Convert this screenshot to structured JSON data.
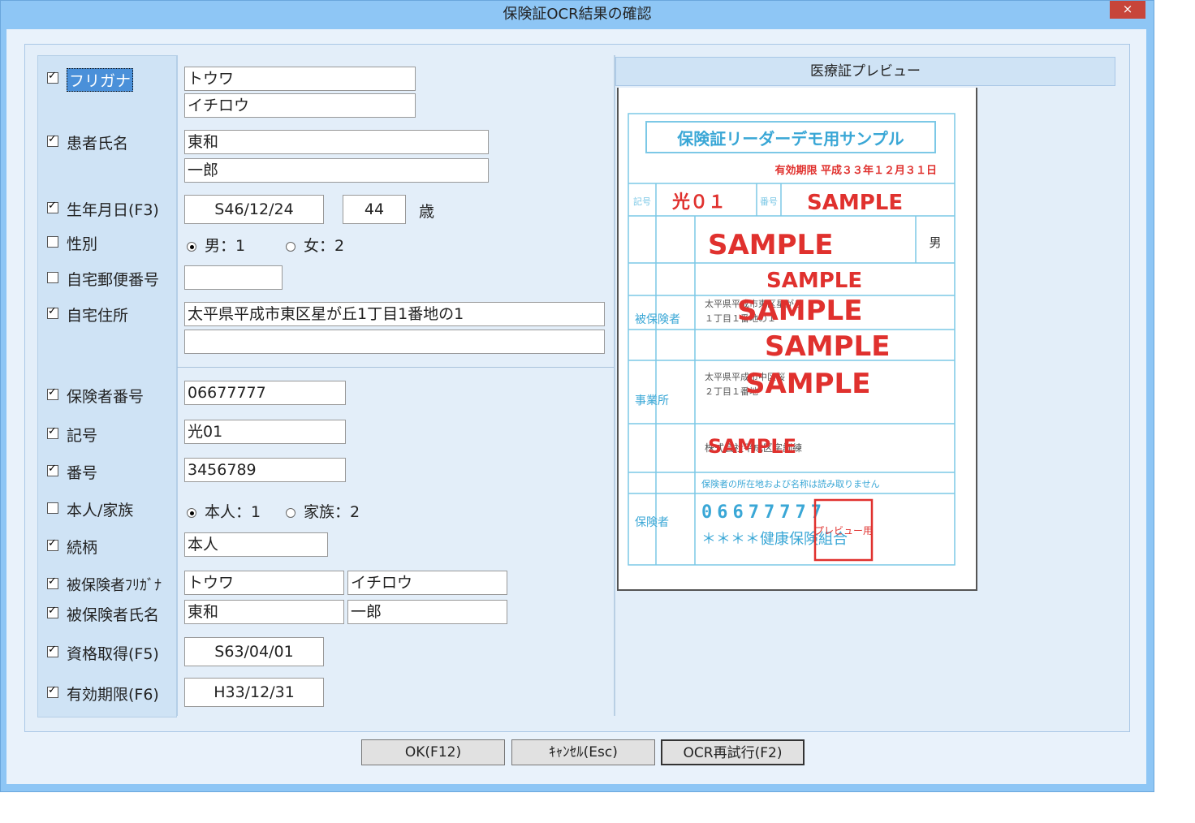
{
  "window": {
    "title": "保険証OCR結果の確認",
    "close_label": "×"
  },
  "fields": {
    "furigana": {
      "label": "フリガナ",
      "checked": true,
      "last": "トウワ",
      "first": "イチロウ"
    },
    "name": {
      "label": "患者氏名",
      "checked": true,
      "last": "東和",
      "first": "一郎"
    },
    "birthday": {
      "label": "生年月日(F3)",
      "checked": true,
      "value": "S46/12/24",
      "age": "44",
      "age_unit": "歳"
    },
    "gender": {
      "label": "性別",
      "checked": false,
      "male": "男：1",
      "female": "女：2",
      "selected": "male"
    },
    "zip": {
      "label": "自宅郵便番号",
      "checked": false,
      "value": ""
    },
    "address": {
      "label": "自宅住所",
      "checked": true,
      "line1": "太平県平成市東区星が丘1丁目1番地の1",
      "line2": ""
    },
    "insurer_no": {
      "label": "保険者番号",
      "checked": true,
      "value": "06677777"
    },
    "symbol": {
      "label": "記号",
      "checked": true,
      "value": "光01"
    },
    "number": {
      "label": "番号",
      "checked": true,
      "value": "3456789"
    },
    "self_family": {
      "label": "本人/家族",
      "checked": false,
      "self": "本人：1",
      "family": "家族：2",
      "selected": "self"
    },
    "relation": {
      "label": "続柄",
      "checked": true,
      "value": "本人"
    },
    "insured_kana": {
      "label": "被保険者ﾌﾘｶﾞﾅ",
      "checked": true,
      "last": "トウワ",
      "first": "イチロウ"
    },
    "insured_name": {
      "label": "被保険者氏名",
      "checked": true,
      "last": "東和",
      "first": "一郎"
    },
    "qualified": {
      "label": "資格取得(F5)",
      "checked": true,
      "value": "S63/04/01"
    },
    "expiry": {
      "label": "有効期限(F6)",
      "checked": true,
      "value": "H33/12/31"
    }
  },
  "preview": {
    "title": "医療証プレビュー",
    "card_title": "保険証リーダーデモ用サンプル",
    "card_expiry": "有効期限 平成３３年１２月３１日",
    "symbol_label": "記号",
    "symbol_value": "光０１",
    "number_label": "番号",
    "sample": "SAMPLE",
    "gender": "男",
    "insured_label": "被保険者",
    "office_label": "事業所",
    "insurer_label": "保険者",
    "insurer_digits": "06677777",
    "insurer_name": "＊＊＊＊健康保険組合",
    "address_small": "太平県平成市東区星が丘",
    "address_small2": "１丁目１番地の１",
    "office_addr": "太平県平成市中区桜",
    "office_addr2": "２丁目１番地",
    "office_name": "株式会社平成区字訓練",
    "insurer_note": "保険者の所在地および名称は読み取りません",
    "seal": "プレビュー用"
  },
  "buttons": {
    "ok": "OK(F12)",
    "cancel": "ｷｬﾝｾﾙ(Esc)",
    "retry": "OCR再試行(F2)"
  }
}
